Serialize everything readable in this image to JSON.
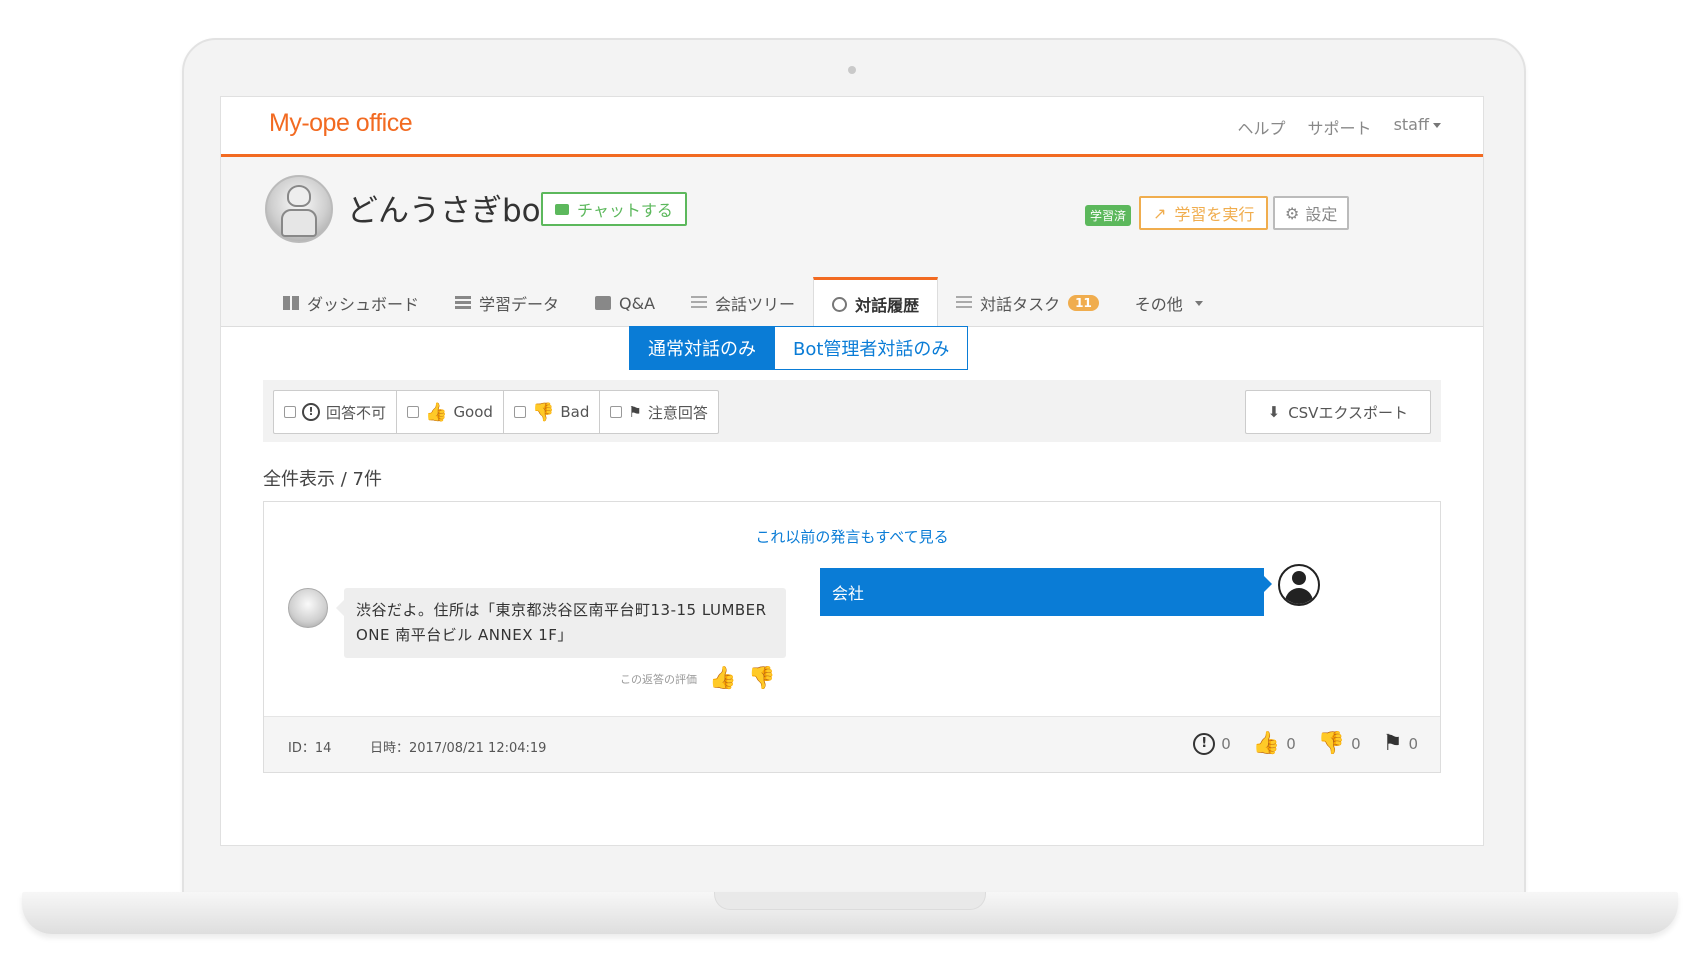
{
  "app": {
    "brand": "My-ope office",
    "top_links": {
      "help": "ヘルプ",
      "support": "サポート",
      "user": "staff"
    }
  },
  "bot": {
    "name": "どんうさぎbot",
    "chat_button": "チャットする",
    "learned_badge": "学習済",
    "learn_button": "学習を実行",
    "settings_button": "設定"
  },
  "tabs": [
    {
      "label": "ダッシュボード",
      "icon": "dashboard-icon"
    },
    {
      "label": "学習データ",
      "icon": "list-icon"
    },
    {
      "label": "Q&A",
      "icon": "qa-icon"
    },
    {
      "label": "会話ツリー",
      "icon": "tree-icon"
    },
    {
      "label": "対話履歴",
      "icon": "history-icon",
      "active": true
    },
    {
      "label": "対話タスク",
      "icon": "task-icon",
      "badge": "11"
    },
    {
      "label": "その他",
      "icon": "caret-icon"
    }
  ],
  "toggle": {
    "normal": "通常対話のみ",
    "admin": "Bot管理者対話のみ"
  },
  "filters": {
    "unanswerable": "回答不可",
    "good": "Good",
    "bad": "Bad",
    "attention": "注意回答"
  },
  "csv_export": "CSVエクスポート",
  "count_label": "全件表示 / 7件",
  "conversation": {
    "see_all": "これ以前の発言もすべて見る",
    "bot_message": "渋谷だよ。住所は「東京都渋谷区南平台町13-15 LUMBER ONE 南平台ビル ANNEX 1F」",
    "rate_label": "この返答の評価",
    "user_message": "会社",
    "id_label": "ID：14",
    "date_label": "日時：2017/08/21 12:04:19",
    "stats": {
      "unanswerable": "0",
      "good": "0",
      "bad": "0",
      "flag": "0"
    }
  },
  "colors": {
    "brand": "#f26a21",
    "primary": "#0a7cd6",
    "success": "#5cb85c",
    "warning": "#f0ad4e",
    "danger": "#d9534f"
  }
}
